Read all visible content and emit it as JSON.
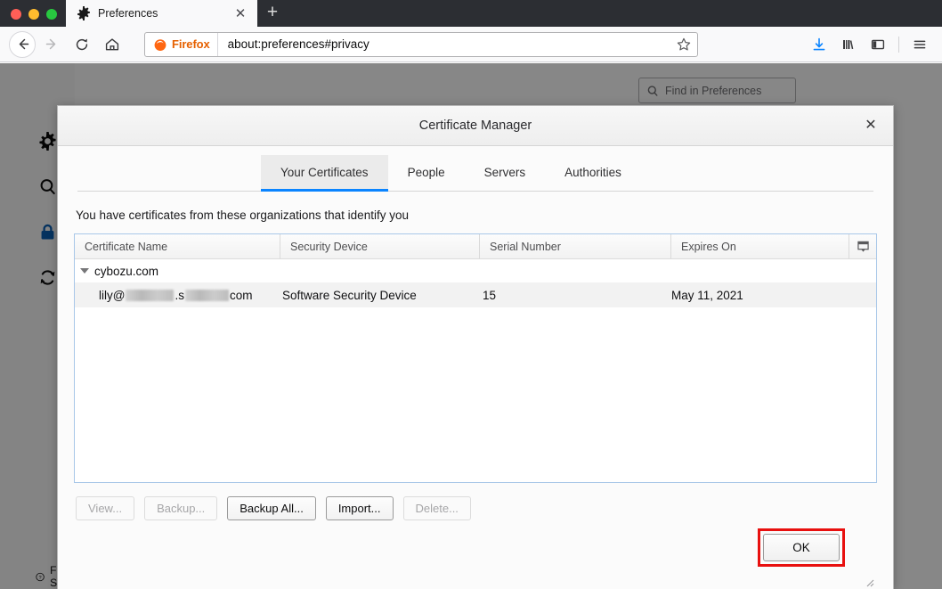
{
  "browser": {
    "window_controls": [
      "close",
      "minimize",
      "zoom"
    ],
    "tab": {
      "title": "Preferences",
      "icon": "gear-icon",
      "close_label": "✕"
    },
    "new_tab_label": "+",
    "nav": {
      "back_icon": "back-arrow-icon",
      "forward_icon": "forward-arrow-icon",
      "reload_icon": "reload-icon",
      "home_icon": "home-icon"
    },
    "url_bar": {
      "identity_label": "Firefox",
      "url": "about:preferences#privacy",
      "bookmark_icon": "star-icon"
    },
    "toolbar_icons": [
      "downloads-icon",
      "library-icon",
      "sidebar-icon",
      "menu-icon"
    ]
  },
  "prefs_page": {
    "sidebar_items": [
      {
        "name": "general",
        "icon": "gear-icon",
        "active": false
      },
      {
        "name": "search",
        "icon": "magnifier-icon",
        "active": false
      },
      {
        "name": "privacy-and-security",
        "icon": "lock-icon",
        "active": true
      },
      {
        "name": "firefox-account",
        "icon": "sync-icon",
        "active": false
      }
    ],
    "search": {
      "placeholder": "Find in Preferences",
      "icon": "search-icon"
    },
    "support_link": {
      "label": "Firefox Support",
      "icon": "question-mark-icon"
    },
    "accent_color": "#0a84ff"
  },
  "dialog": {
    "title": "Certificate Manager",
    "close_label": "✕",
    "tabs": [
      {
        "label": "Your Certificates",
        "active": true
      },
      {
        "label": "People",
        "active": false
      },
      {
        "label": "Servers",
        "active": false
      },
      {
        "label": "Authorities",
        "active": false
      }
    ],
    "description": "You have certificates from these organizations that identify you",
    "table": {
      "columns": [
        "Certificate Name",
        "Security Device",
        "Serial Number",
        "Expires On"
      ],
      "column_picker_icon": "column-picker-icon",
      "groups": [
        {
          "name": "cybozu.com",
          "expanded": true,
          "rows": [
            {
              "certificate_name_prefix": "lily@",
              "certificate_name_middle": ".s",
              "certificate_name_suffix": "com",
              "redacted": true,
              "security_device": "Software Security Device",
              "serial_number": "15",
              "expires_on": "May 11, 2021"
            }
          ]
        }
      ]
    },
    "buttons": [
      {
        "label": "View...",
        "enabled": false
      },
      {
        "label": "Backup...",
        "enabled": false
      },
      {
        "label": "Backup All...",
        "enabled": true
      },
      {
        "label": "Import...",
        "enabled": true
      },
      {
        "label": "Delete...",
        "enabled": false
      }
    ],
    "ok_button": {
      "label": "OK",
      "highlighted": true,
      "highlight_color": "#e8100f"
    }
  }
}
